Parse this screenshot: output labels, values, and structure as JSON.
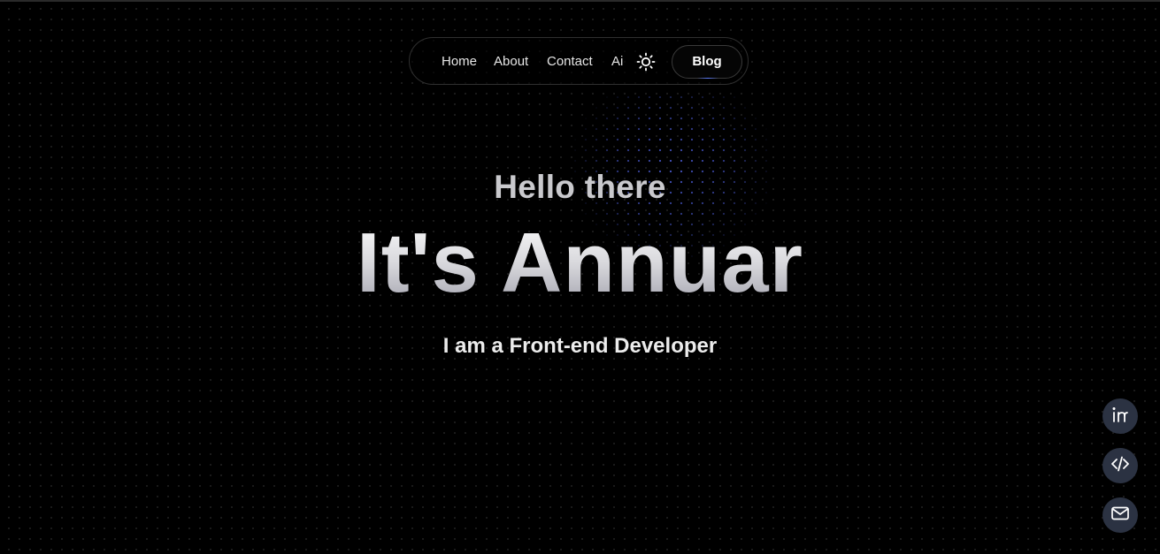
{
  "nav": {
    "home": "Home",
    "about": "About",
    "contact": "Contact",
    "ai": "Ai",
    "theme_toggle_icon": "sun-icon",
    "blog": "Blog"
  },
  "hero": {
    "greeting": "Hello there",
    "name": "It's Annuar",
    "tagline": "I am a Front-end Developer"
  },
  "social": {
    "icons": [
      "linkedin-icon",
      "code-icon",
      "mail-icon"
    ]
  },
  "colors": {
    "background": "#000000",
    "social_button_bg": "#2b3242",
    "accent_blue": "#5a7bff"
  }
}
